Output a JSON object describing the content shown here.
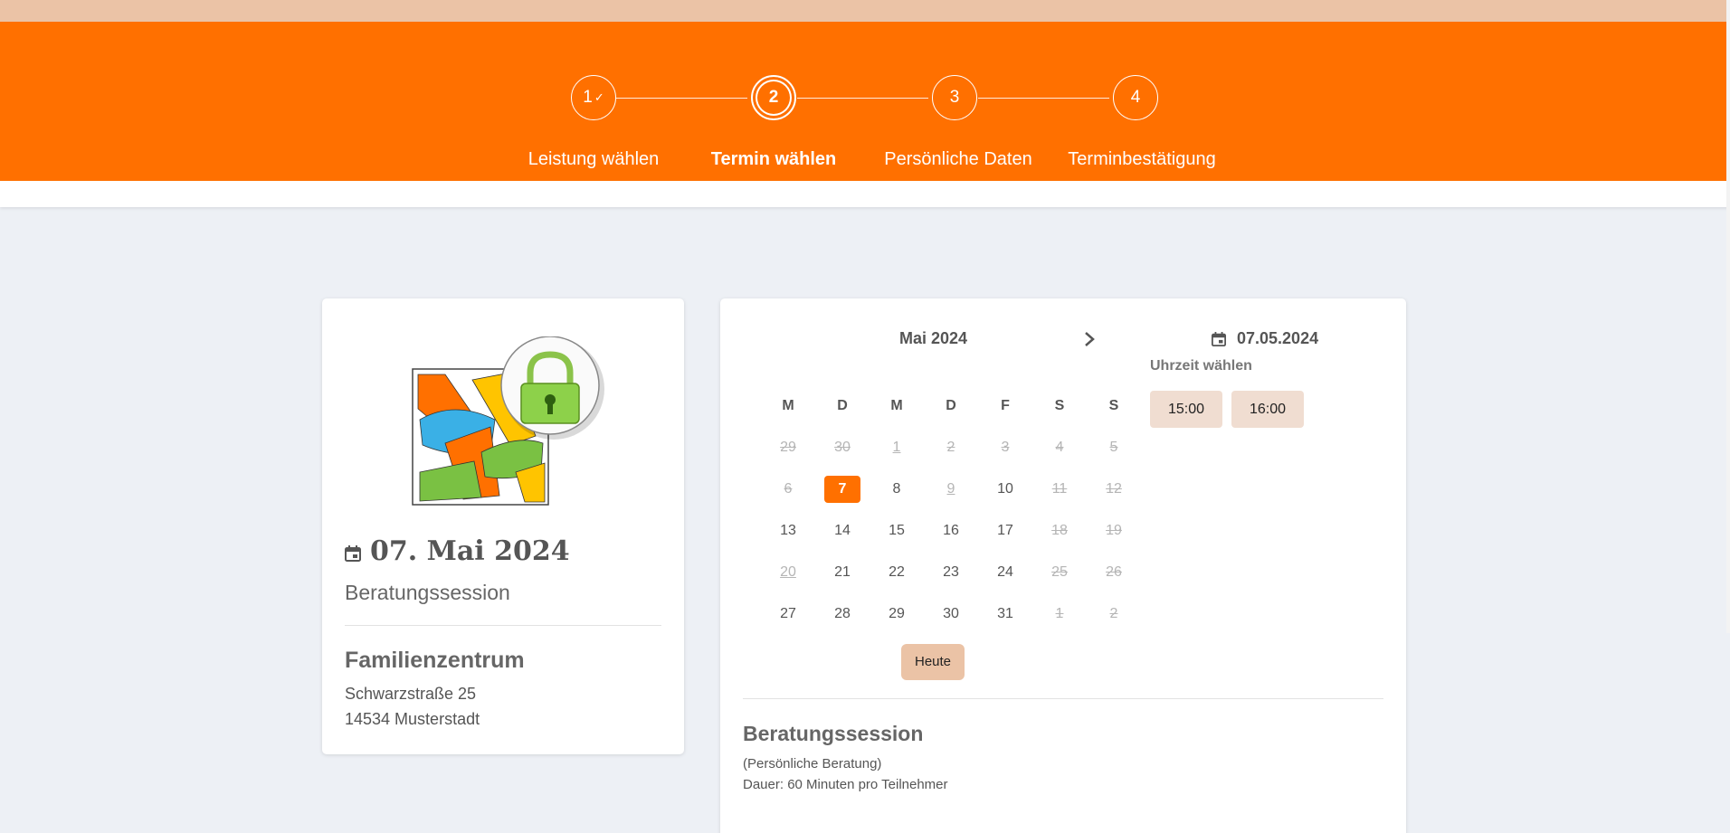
{
  "stepper": {
    "steps": [
      {
        "number": "1",
        "label": "Leistung wählen",
        "done": true
      },
      {
        "number": "2",
        "label": "Termin wählen",
        "active": true
      },
      {
        "number": "3",
        "label": "Persönliche Daten"
      },
      {
        "number": "4",
        "label": "Terminbestätigung"
      }
    ],
    "check_glyph": "✓"
  },
  "summary": {
    "icon": "calendar-icon",
    "date": "07. Mai 2024",
    "service": "Beratungssession",
    "location_name": "Familienzentrum",
    "street": "Schwarzstraße 25",
    "city": "14534 Musterstadt"
  },
  "calendar": {
    "month": "Mai 2024",
    "next_icon": "chevron-right-icon",
    "weekdays": [
      "M",
      "D",
      "M",
      "D",
      "F",
      "S",
      "S"
    ],
    "weeks": [
      [
        "29",
        "30",
        "1",
        "2",
        "3",
        "4",
        "5"
      ],
      [
        "6",
        "7",
        "8",
        "9",
        "10",
        "11",
        "12"
      ],
      [
        "13",
        "14",
        "15",
        "16",
        "17",
        "18",
        "19"
      ],
      [
        "20",
        "21",
        "22",
        "23",
        "24",
        "25",
        "26"
      ],
      [
        "27",
        "28",
        "29",
        "30",
        "31",
        "1",
        "2"
      ]
    ],
    "today_label": "Heute"
  },
  "times": {
    "selected_date": "07.05.2024",
    "label": "Uhrzeit wählen",
    "slots": [
      "15:00",
      "16:00"
    ]
  },
  "details": {
    "title": "Beratungssession",
    "type": "(Persönliche Beratung)",
    "duration": "Dauer: 60 Minuten pro Teilnehmer"
  },
  "colors": {
    "brand_orange": "#ff7000",
    "top_strip": "#ebc3a6",
    "slot_bg": "#f0ddd1",
    "background": "#edf0f5"
  }
}
